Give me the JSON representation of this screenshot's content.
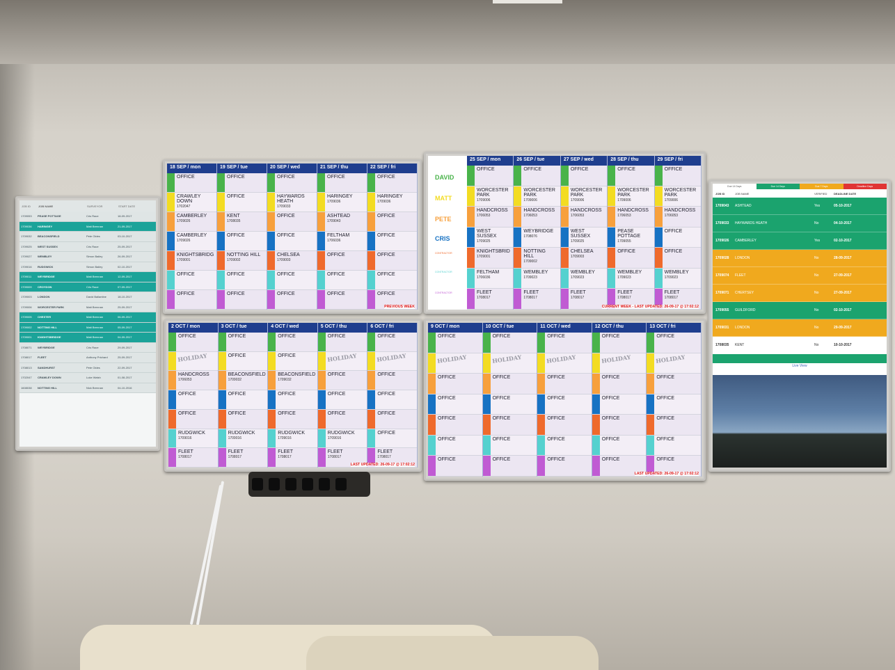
{
  "list_screen": {
    "headers": [
      "JOB ID",
      "JOB NAME",
      "SURVEYOR",
      "START DATE"
    ],
    "rows": [
      {
        "id": "1709053",
        "job": "PEASE POTTAGE",
        "surv": "Cris Race",
        "date": "18-09-2017",
        "style": "grey"
      },
      {
        "id": "1709036",
        "job": "HARINGEY",
        "surv": "Matt Brennan",
        "date": "21-09-2017",
        "style": "teal"
      },
      {
        "id": "1709032",
        "job": "BEACONSFIELD",
        "surv": "Pete Oldes",
        "date": "03-10-2017",
        "style": "grey"
      },
      {
        "id": "1709025",
        "job": "WEST SUSSEX",
        "surv": "Cris Race",
        "date": "25-09-2017",
        "style": "grey"
      },
      {
        "id": "1709027",
        "job": "WEMBLEY",
        "surv": "Simon Bailey",
        "date": "26-09-2017",
        "style": "grey"
      },
      {
        "id": "1709016",
        "job": "RUDGWICK",
        "surv": "Simon Bailey",
        "date": "02-10-2017",
        "style": "grey"
      },
      {
        "id": "1709011",
        "job": "WEYBRIDGE",
        "surv": "Matt Brennan",
        "date": "12-09-2017",
        "style": "teal"
      },
      {
        "id": "1709009",
        "job": "CROYDON",
        "surv": "Cris Race",
        "date": "07-09-2017",
        "style": "teal"
      },
      {
        "id": "1709003",
        "job": "LONDON",
        "surv": "David Ballantine",
        "date": "18-10-2017",
        "style": "grey"
      },
      {
        "id": "1709006",
        "job": "WORCESTER PARK",
        "surv": "Matt Brennan",
        "date": "25-09-2017",
        "style": "grey"
      },
      {
        "id": "1709005",
        "job": "CHESTER",
        "surv": "Matt Brennan",
        "date": "06-09-2017",
        "style": "teal"
      },
      {
        "id": "1709002",
        "job": "NOTTING HILL",
        "surv": "Matt Brennan",
        "date": "05-09-2017",
        "style": "teal"
      },
      {
        "id": "1709001",
        "job": "KNIGHTSBRIDGE",
        "surv": "Matt Brennan",
        "date": "04-09-2017",
        "style": "teal"
      },
      {
        "id": "1708071",
        "job": "WEYBRIDGE",
        "surv": "Cris Race",
        "date": "29-09-2017",
        "style": "grey"
      },
      {
        "id": "1708017",
        "job": "FLEET",
        "surv": "Anthony Prichard",
        "date": "25-09-2017",
        "style": "grey"
      },
      {
        "id": "1708013",
        "job": "SANDHURST",
        "surv": "Pete Oldes",
        "date": "22-09-2017",
        "style": "grey"
      },
      {
        "id": "1702047",
        "job": "CRAWLEY DOWN",
        "surv": "Luke Walsh",
        "date": "01-08-2017",
        "style": "grey"
      },
      {
        "id": "1608038",
        "job": "NOTTING HILL",
        "surv": "Nick Brennan",
        "date": "04-10-2016",
        "style": "grey"
      }
    ]
  },
  "people": {
    "david": "DAVID",
    "matt": "MATT",
    "pete": "PETE",
    "cris": "CRIS",
    "contractor1": "CONTRACTOR",
    "contractor2": "CONTRACTOR",
    "contractor3": "CONTRACTOR"
  },
  "weeks": {
    "previous": {
      "footer": "PREVIOUS WEEK",
      "days": [
        {
          "label": "18 SEP / mon",
          "cells": [
            {
              "t": "OFFICE"
            },
            {
              "t": "CRAWLEY\nDOWN",
              "n": "1702047"
            },
            {
              "t": "CAMBERLEY",
              "n": "1709026"
            },
            {
              "t": "CAMBERLEY",
              "n": "1709026"
            },
            {
              "t": "KNIGHTSBRIDG",
              "n": "1709001"
            },
            {
              "t": "OFFICE"
            },
            {
              "t": "OFFICE"
            }
          ]
        },
        {
          "label": "19 SEP / tue",
          "cells": [
            {
              "t": "OFFICE"
            },
            {
              "t": "OFFICE"
            },
            {
              "t": "KENT",
              "n": "1708035"
            },
            {
              "t": "OFFICE"
            },
            {
              "t": "NOTTING HILL",
              "n": "1709002"
            },
            {
              "t": "OFFICE"
            },
            {
              "t": "OFFICE"
            }
          ]
        },
        {
          "label": "20 SEP / wed",
          "cells": [
            {
              "t": "OFFICE"
            },
            {
              "t": "HAYWARDS\nHEATH",
              "n": "1709033"
            },
            {
              "t": "OFFICE"
            },
            {
              "t": "OFFICE"
            },
            {
              "t": "CHELSEA",
              "n": "1709003"
            },
            {
              "t": "OFFICE"
            },
            {
              "t": "OFFICE"
            }
          ]
        },
        {
          "label": "21 SEP / thu",
          "cells": [
            {
              "t": "OFFICE"
            },
            {
              "t": "HARINGEY",
              "n": "1709036"
            },
            {
              "t": "ASHTEAD",
              "n": "1709043"
            },
            {
              "t": "FELTHAM",
              "n": "1706036"
            },
            {
              "t": "OFFICE"
            },
            {
              "t": "OFFICE"
            },
            {
              "t": "OFFICE"
            }
          ]
        },
        {
          "label": "22 SEP / fri",
          "cells": [
            {
              "t": "OFFICE"
            },
            {
              "t": "HARINGEY",
              "n": "1709036"
            },
            {
              "t": "OFFICE"
            },
            {
              "t": "OFFICE"
            },
            {
              "t": "OFFICE"
            },
            {
              "t": "OFFICE"
            },
            {
              "t": "OFFICE"
            }
          ]
        }
      ]
    },
    "current": {
      "footer": "CURRENT WEEK - LAST UPDATED: 26-09-17 @ 17:02:12",
      "days": [
        {
          "label": "25 SEP / mon",
          "cells": [
            {
              "t": "OFFICE"
            },
            {
              "t": "WORCESTER\nPARK",
              "n": "1709006"
            },
            {
              "t": "HANDCROSS",
              "n": "1706053"
            },
            {
              "t": "WEST\nSUSSEX",
              "n": "1709025"
            },
            {
              "t": "KNIGHTSBRID",
              "n": "1709001"
            },
            {
              "t": "FELTHAM",
              "n": "1706036"
            },
            {
              "t": "FLEET",
              "n": "1708017"
            }
          ]
        },
        {
          "label": "26 SEP / tue",
          "cells": [
            {
              "t": "OFFICE"
            },
            {
              "t": "WORCESTER\nPARK",
              "n": "1709006"
            },
            {
              "t": "HANDCROSS",
              "n": "1706053"
            },
            {
              "t": "WEYBRIDGE",
              "n": "1708076"
            },
            {
              "t": "NOTTING\nHILL",
              "n": "1709002"
            },
            {
              "t": "WEMBLEY",
              "n": "1709023"
            },
            {
              "t": "FLEET",
              "n": "1708017"
            }
          ]
        },
        {
          "label": "27 SEP / wed",
          "cells": [
            {
              "t": "OFFICE"
            },
            {
              "t": "WORCESTER\nPARK",
              "n": "1709006"
            },
            {
              "t": "HANDCROSS",
              "n": "1706053"
            },
            {
              "t": "WEST\nSUSSEX",
              "n": "1709025"
            },
            {
              "t": "CHELSEA",
              "n": "1709003"
            },
            {
              "t": "WEMBLEY",
              "n": "1709023"
            },
            {
              "t": "FLEET",
              "n": "1708017"
            }
          ]
        },
        {
          "label": "28 SEP / thu",
          "cells": [
            {
              "t": "OFFICE"
            },
            {
              "t": "WORCESTER\nPARK",
              "n": "1709006"
            },
            {
              "t": "HANDCROSS",
              "n": "1706053"
            },
            {
              "t": "PEASE\nPOTTAGE",
              "n": "1709055"
            },
            {
              "t": "OFFICE"
            },
            {
              "t": "WEMBLEY",
              "n": "1709023"
            },
            {
              "t": "FLEET",
              "n": "1708017"
            }
          ]
        },
        {
          "label": "29 SEP / fri",
          "cells": [
            {
              "t": "OFFICE"
            },
            {
              "t": "WORCESTER\nPARK",
              "n": "1709006"
            },
            {
              "t": "HANDCROSS",
              "n": "1706053"
            },
            {
              "t": "OFFICE"
            },
            {
              "t": "OFFICE"
            },
            {
              "t": "WEMBLEY",
              "n": "1709023"
            },
            {
              "t": "FLEET",
              "n": "1708017"
            }
          ]
        }
      ]
    },
    "next1": {
      "footer": "LAST UPDATED: 26-09-17 @ 17:02:12",
      "days": [
        {
          "label": "2 OCT / mon",
          "cells": [
            {
              "t": "OFFICE"
            },
            {
              "t": "HOLIDAY",
              "h": true
            },
            {
              "t": "HANDCROSS",
              "n": "1706053"
            },
            {
              "t": "OFFICE"
            },
            {
              "t": "OFFICE"
            },
            {
              "t": "RUDGWICK",
              "n": "1709016"
            },
            {
              "t": "FLEET",
              "n": "1708017"
            }
          ]
        },
        {
          "label": "3 OCT / tue",
          "cells": [
            {
              "t": "OFFICE"
            },
            {
              "t": "OFFICE"
            },
            {
              "t": "BEACONSFIELD",
              "n": "1709032"
            },
            {
              "t": "OFFICE"
            },
            {
              "t": "OFFICE"
            },
            {
              "t": "RUDGWICK",
              "n": "1709016"
            },
            {
              "t": "FLEET",
              "n": "1708017"
            }
          ]
        },
        {
          "label": "4 OCT / wed",
          "cells": [
            {
              "t": "OFFICE"
            },
            {
              "t": "OFFICE"
            },
            {
              "t": "BEACONSFIELD",
              "n": "1709032"
            },
            {
              "t": "OFFICE"
            },
            {
              "t": "OFFICE"
            },
            {
              "t": "RUDGWICK",
              "n": "1709016"
            },
            {
              "t": "FLEET",
              "n": "1708017"
            }
          ]
        },
        {
          "label": "5 OCT / thu",
          "cells": [
            {
              "t": "OFFICE"
            },
            {
              "t": "HOLIDAY",
              "h": true
            },
            {
              "t": "OFFICE"
            },
            {
              "t": "OFFICE"
            },
            {
              "t": "OFFICE"
            },
            {
              "t": "RUDGWICK",
              "n": "1709016"
            },
            {
              "t": "FLEET",
              "n": "1708017"
            }
          ]
        },
        {
          "label": "6 OCT / fri",
          "cells": [
            {
              "t": "OFFICE"
            },
            {
              "t": "HOLIDAY",
              "h": true
            },
            {
              "t": "OFFICE"
            },
            {
              "t": "OFFICE"
            },
            {
              "t": "OFFICE"
            },
            {
              "t": "OFFICE"
            },
            {
              "t": "FLEET",
              "n": "1708017"
            }
          ]
        }
      ]
    },
    "next2": {
      "footer": "LAST UPDATED: 26-09-17 @ 17:02:12",
      "days": [
        {
          "label": "9 OCT / mon",
          "cells": [
            {
              "t": "OFFICE"
            },
            {
              "t": "HOLIDAY",
              "h": true
            },
            {
              "t": "OFFICE"
            },
            {
              "t": "OFFICE"
            },
            {
              "t": "OFFICE"
            },
            {
              "t": "OFFICE"
            },
            {
              "t": "OFFICE"
            }
          ]
        },
        {
          "label": "10 OCT / tue",
          "cells": [
            {
              "t": "OFFICE"
            },
            {
              "t": "HOLIDAY",
              "h": true
            },
            {
              "t": "OFFICE"
            },
            {
              "t": "OFFICE"
            },
            {
              "t": "OFFICE"
            },
            {
              "t": "OFFICE"
            },
            {
              "t": "OFFICE"
            }
          ]
        },
        {
          "label": "11 OCT / wed",
          "cells": [
            {
              "t": "OFFICE"
            },
            {
              "t": "HOLIDAY",
              "h": true
            },
            {
              "t": "OFFICE"
            },
            {
              "t": "OFFICE"
            },
            {
              "t": "OFFICE"
            },
            {
              "t": "OFFICE"
            },
            {
              "t": "OFFICE"
            }
          ]
        },
        {
          "label": "12 OCT / thu",
          "cells": [
            {
              "t": "OFFICE"
            },
            {
              "t": "HOLIDAY",
              "h": true
            },
            {
              "t": "OFFICE"
            },
            {
              "t": "OFFICE"
            },
            {
              "t": "OFFICE"
            },
            {
              "t": "OFFICE"
            },
            {
              "t": "OFFICE"
            }
          ]
        },
        {
          "label": "13 OCT / fri",
          "cells": [
            {
              "t": "OFFICE"
            },
            {
              "t": "HOLIDAY",
              "h": true
            },
            {
              "t": "OFFICE"
            },
            {
              "t": "OFFICE"
            },
            {
              "t": "OFFICE"
            },
            {
              "t": "OFFICE"
            },
            {
              "t": "OFFICE"
            }
          ]
        }
      ]
    }
  },
  "row_colors": [
    "#49b34a",
    "#f3dc22",
    "#f7a03c",
    "#1772c3",
    "#ef6a2c",
    "#55d1cf",
    "#c05bd3"
  ],
  "right_screen": {
    "tabs": [
      "Due 14 Days",
      "Due 14 Days",
      "Due 7 Days",
      "Deadline Days"
    ],
    "headers": [
      "JOB ID",
      "JOB NAME",
      "VERIFIED",
      "DEADLINE DATE"
    ],
    "rows": [
      {
        "id": "1709043",
        "job": "ASHTEAD",
        "ver": "Yes",
        "date": "05-10-2017",
        "style": "green"
      },
      {
        "id": "1709033",
        "job": "HAYWARDS HEATH",
        "ver": "No",
        "date": "04-10-2017",
        "style": "green"
      },
      {
        "id": "1709026",
        "job": "CAMBERLEY",
        "ver": "Yes",
        "date": "02-10-2017",
        "style": "green"
      },
      {
        "id": "1709028",
        "job": "LONDON",
        "ver": "No",
        "date": "28-09-2017",
        "style": "amber"
      },
      {
        "id": "1709074",
        "job": "FLEET",
        "ver": "No",
        "date": "27-09-2017",
        "style": "amber"
      },
      {
        "id": "1709071",
        "job": "CHERTSEY",
        "ver": "No",
        "date": "27-09-2017",
        "style": "amber"
      },
      {
        "id": "1709055",
        "job": "GUILDFORD",
        "ver": "No",
        "date": "02-10-2017",
        "style": "green"
      },
      {
        "id": "1709031",
        "job": "LONDON",
        "ver": "No",
        "date": "29-09-2017",
        "style": "amber"
      },
      {
        "id": "1708035",
        "job": "KENT",
        "ver": "No",
        "date": "10-10-2017",
        "style": "white"
      }
    ],
    "live_view": "Live View"
  }
}
